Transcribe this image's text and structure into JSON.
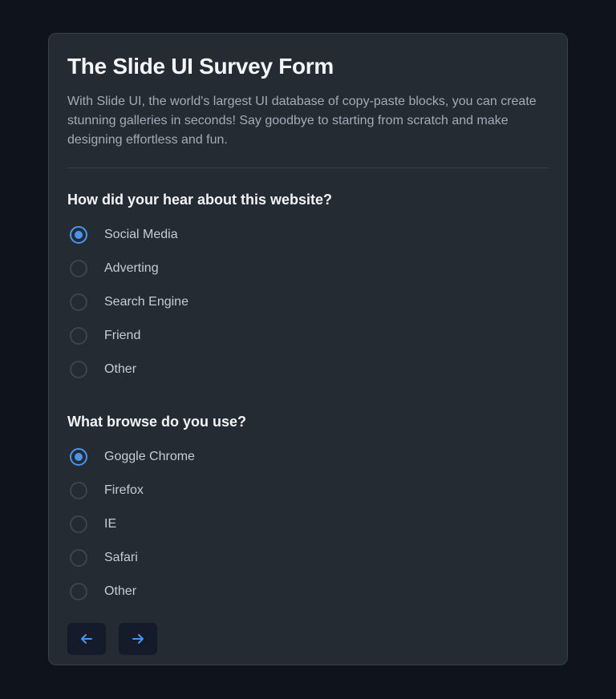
{
  "form": {
    "title": "The Slide UI Survey Form",
    "description": "With Slide UI, the world's largest UI database of copy-paste blocks, you can create stunning galleries in seconds! Say goodbye to starting from scratch and make designing effortless and fun."
  },
  "questions": [
    {
      "label": "How did your hear about this website?",
      "options": [
        {
          "label": "Social Media",
          "checked": true
        },
        {
          "label": "Adverting",
          "checked": false
        },
        {
          "label": "Search Engine",
          "checked": false
        },
        {
          "label": "Friend",
          "checked": false
        },
        {
          "label": "Other",
          "checked": false
        }
      ]
    },
    {
      "label": "What browse do you use?",
      "options": [
        {
          "label": "Goggle Chrome",
          "checked": true
        },
        {
          "label": "Firefox",
          "checked": false
        },
        {
          "label": "IE",
          "checked": false
        },
        {
          "label": "Safari",
          "checked": false
        },
        {
          "label": "Other",
          "checked": false
        }
      ]
    }
  ],
  "navigation": {
    "prev_icon": "arrow-left-icon",
    "next_icon": "arrow-right-icon"
  },
  "colors": {
    "page_background": "#0e131c",
    "card_background": "#252b33",
    "accent": "#4a94ee",
    "nav_button_background": "#141c2b"
  }
}
